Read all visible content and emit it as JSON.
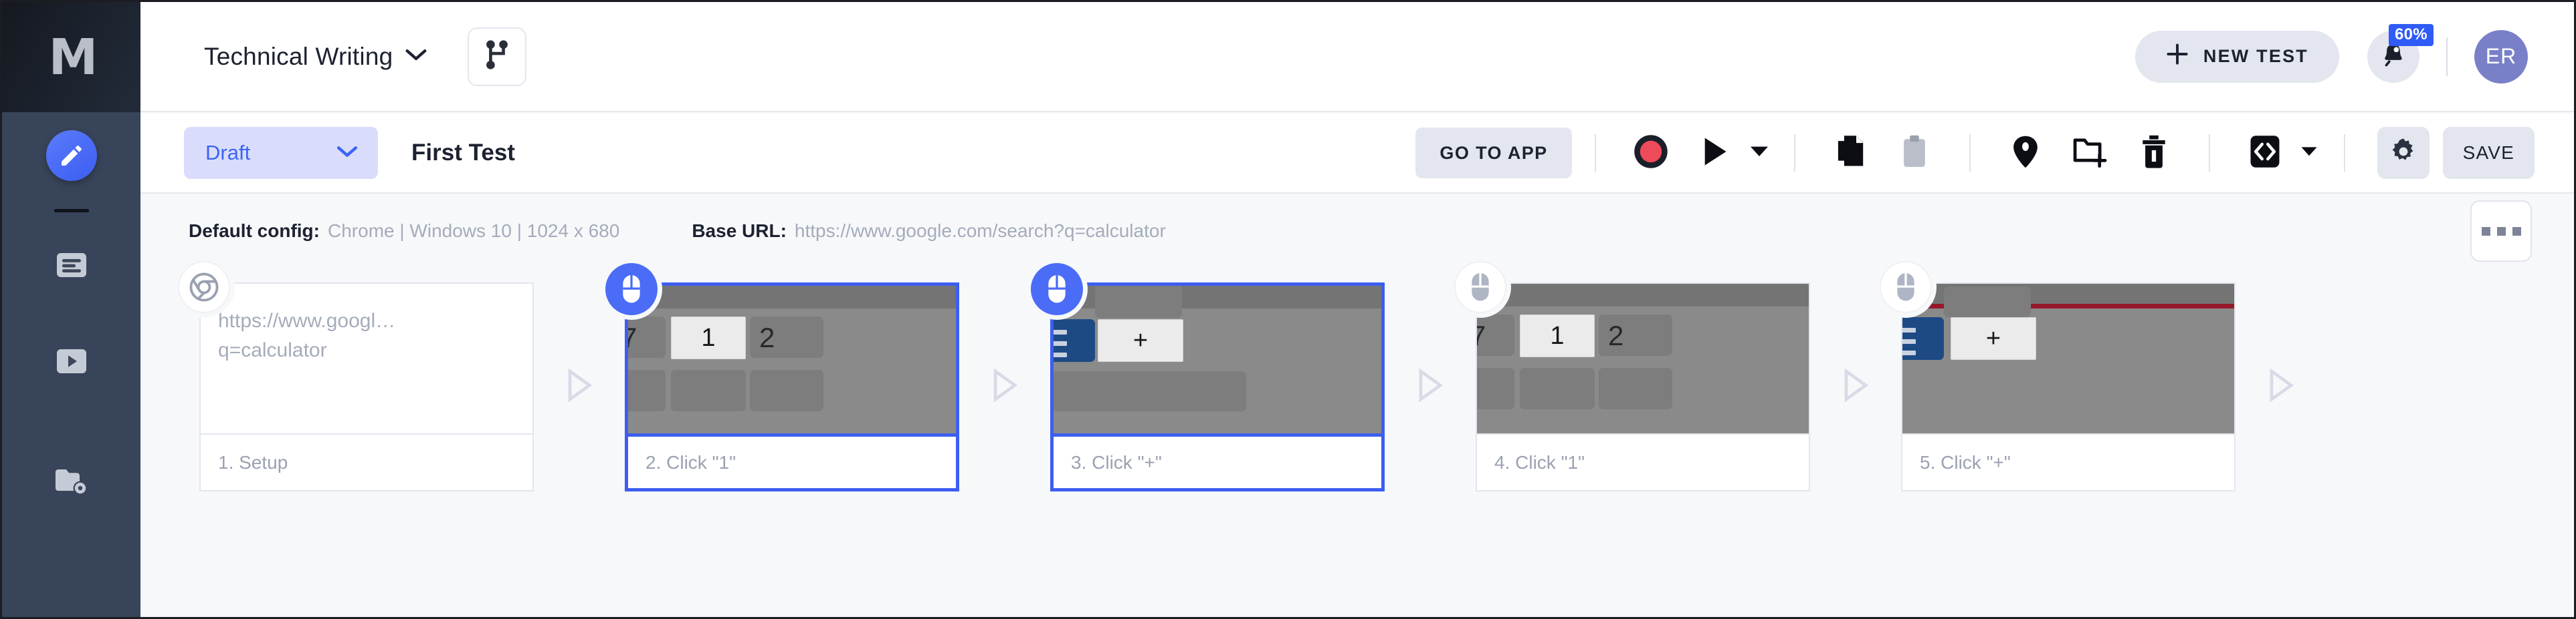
{
  "app": {
    "logo_glyph": "M",
    "accent": "#4a6cf7",
    "rail_bg": "#384459",
    "canvas_bg": "#f7f8fa"
  },
  "sidebar": {
    "items": [
      {
        "name": "editor",
        "icon": "pencil-icon",
        "active": true
      },
      {
        "name": "reports",
        "icon": "document-list-icon",
        "active": false
      },
      {
        "name": "runs",
        "icon": "play-video-icon",
        "active": false
      },
      {
        "name": "settings",
        "icon": "folder-gear-icon",
        "active": false
      }
    ]
  },
  "header": {
    "project_name": "Technical Writing",
    "project_caret": "chevron-down-icon",
    "branch_icon": "git-branch-icon",
    "new_test_label": "NEW TEST",
    "new_test_icon": "plus-icon",
    "notification_icon": "bell-icon",
    "notification_badge": "60%",
    "avatar_initials": "ER"
  },
  "toolbar": {
    "status_value": "Draft",
    "status_caret": "chevron-down-icon",
    "test_name": "First Test",
    "go_to_app_label": "GO TO APP",
    "save_label": "SAVE",
    "icons": [
      {
        "name": "record-button",
        "icon": "record-circle-icon"
      },
      {
        "name": "run-button",
        "icon": "play-triangle-icon"
      },
      {
        "name": "run-options",
        "icon": "caret-down-icon"
      },
      {
        "name": "copy-button",
        "icon": "copy-pages-icon"
      },
      {
        "name": "paste-button",
        "icon": "clipboard-icon"
      },
      {
        "name": "tag-button",
        "icon": "tag-icon"
      },
      {
        "name": "move-to-folder-button",
        "icon": "folder-plus-icon"
      },
      {
        "name": "delete-button",
        "icon": "trash-icon"
      },
      {
        "name": "code-button",
        "icon": "code-brackets-icon"
      },
      {
        "name": "code-options",
        "icon": "caret-down-icon"
      },
      {
        "name": "settings-button",
        "icon": "gear-icon"
      }
    ]
  },
  "config": {
    "default_config_label": "Default config:",
    "default_config_value": "Chrome | Windows 10 | 1024 x 680",
    "base_url_label": "Base URL:",
    "base_url_value": "https://www.google.com/search?q=calculator",
    "more_menu_icon": "ellipsis-icon"
  },
  "steps": [
    {
      "kind": "setup",
      "badge": "chrome-icon",
      "badge_style": "white",
      "url_text": "https://www.googl… q=calculator",
      "url_line1": "https://www.googl…",
      "url_line2": "q=calculator",
      "caption": "1. Setup",
      "selected": false
    },
    {
      "kind": "click",
      "badge": "mouse-click-icon",
      "badge_style": "blue",
      "thumb": "calculator-key-1",
      "key_label": "1",
      "caption": "2. Click \"1\"",
      "selected": true
    },
    {
      "kind": "click",
      "badge": "mouse-click-icon",
      "badge_style": "blue",
      "thumb": "calculator-key-plus",
      "key_label": "+",
      "caption": "3. Click \"+\"",
      "selected": true
    },
    {
      "kind": "click",
      "badge": "mouse-click-icon",
      "badge_style": "white",
      "thumb": "calculator-key-1",
      "key_label": "1",
      "caption": "4. Click \"1\"",
      "selected": false
    },
    {
      "kind": "click",
      "badge": "mouse-click-icon",
      "badge_style": "white",
      "thumb": "calculator-key-plus-red",
      "key_label": "+",
      "caption": "5. Click \"+\"",
      "selected": false
    }
  ],
  "separators": {
    "arrow_icon": "triangle-right-outline-icon",
    "count": 5
  }
}
